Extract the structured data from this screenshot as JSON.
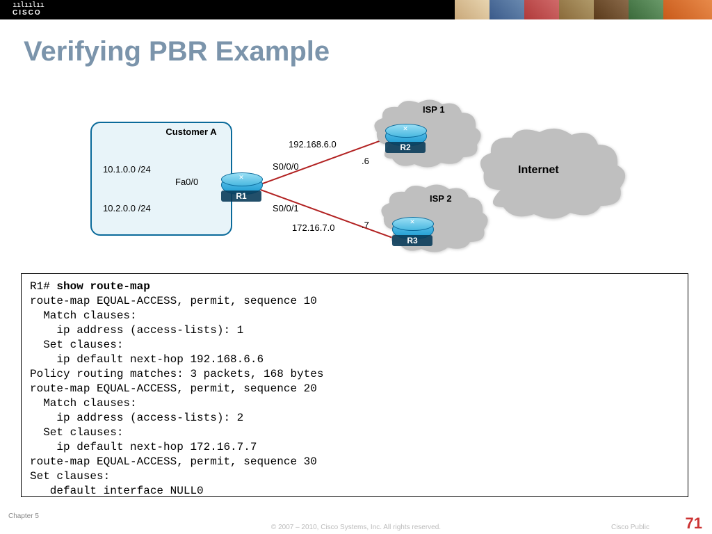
{
  "header": {
    "logo_bars": "ıılıılıı",
    "logo_text": "CISCO"
  },
  "title": "Verifying PBR Example",
  "diagram": {
    "customer_label": "Customer A",
    "net1": "10.1.0.0 /24",
    "net2": "10.2.0.0 /24",
    "if_fa00": "Fa0/0",
    "if_s000": "S0/0/0",
    "if_s001": "S0/0/1",
    "subnet_top": "192.168.6.0",
    "hop_top": ".6",
    "subnet_bot": "172.16.7.0",
    "hop_bot": ".7",
    "r1": "R1",
    "r2": "R2",
    "r3": "R3",
    "isp1": "ISP 1",
    "isp2": "ISP 2",
    "internet": "Internet"
  },
  "terminal": {
    "prompt": "R1# ",
    "command": "show route-map",
    "body": "route-map EQUAL-ACCESS, permit, sequence 10\n  Match clauses:\n    ip address (access-lists): 1\n  Set clauses:\n    ip default next-hop 192.168.6.6\nPolicy routing matches: 3 packets, 168 bytes\nroute-map EQUAL-ACCESS, permit, sequence 20\n  Match clauses:\n    ip address (access-lists): 2\n  Set clauses:\n    ip default next-hop 172.16.7.7\nroute-map EQUAL-ACCESS, permit, sequence 30\nSet clauses:\n   default interface NULL0"
  },
  "footer": {
    "chapter": "Chapter 5",
    "copyright": "© 2007 – 2010, Cisco Systems, Inc. All rights reserved.",
    "cisco_public": "Cisco Public",
    "page": "71"
  },
  "chart_data": {
    "type": "network-diagram",
    "nodes": [
      {
        "id": "CustomerA",
        "label": "Customer A",
        "subnets": [
          "10.1.0.0/24",
          "10.2.0.0/24"
        ]
      },
      {
        "id": "R1",
        "type": "router",
        "interfaces": [
          "Fa0/0",
          "S0/0/0",
          "S0/0/1"
        ]
      },
      {
        "id": "R2",
        "type": "router",
        "cloud": "ISP 1"
      },
      {
        "id": "R3",
        "type": "router",
        "cloud": "ISP 2"
      },
      {
        "id": "Internet",
        "type": "cloud"
      }
    ],
    "links": [
      {
        "from": "CustomerA",
        "to": "R1",
        "via": "Fa0/0"
      },
      {
        "from": "R1",
        "to": "R2",
        "via": "S0/0/0",
        "subnet": "192.168.6.0",
        "remote": ".6"
      },
      {
        "from": "R1",
        "to": "R3",
        "via": "S0/0/1",
        "subnet": "172.16.7.0",
        "remote": ".7"
      },
      {
        "from": "ISP 1",
        "to": "Internet"
      },
      {
        "from": "ISP 2",
        "to": "Internet"
      }
    ]
  }
}
